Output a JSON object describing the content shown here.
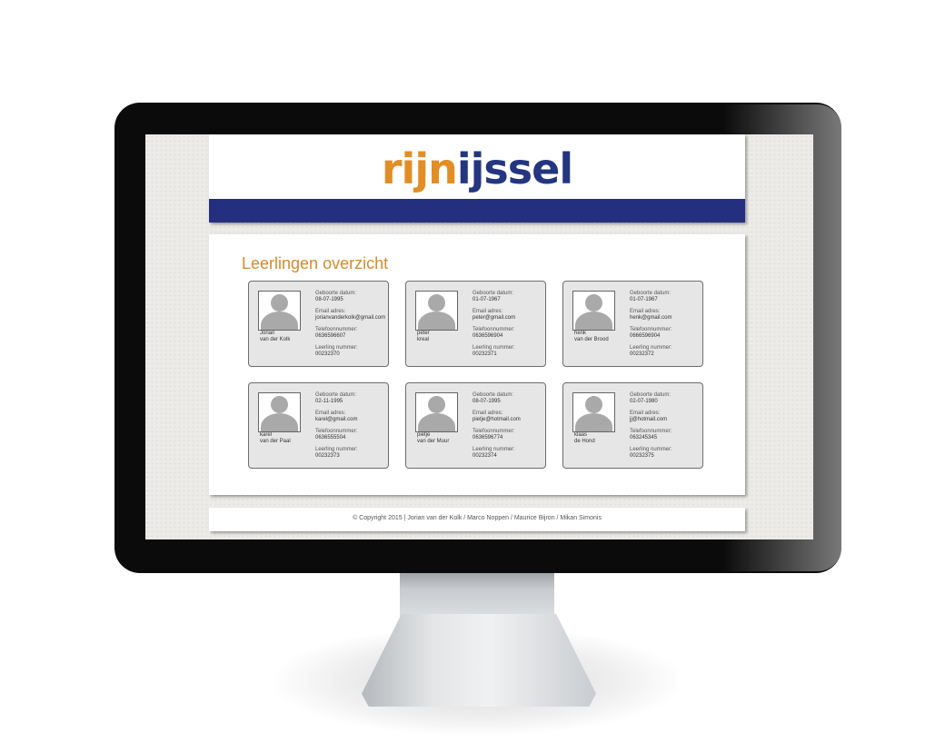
{
  "logo": {
    "part1": "rijn",
    "part2": "ijssel"
  },
  "page_title": "Leerlingen overzicht",
  "labels": {
    "birth": "Geboorte datum:",
    "email": "Email adres:",
    "phone": "Telefoonnummer:",
    "number": "Leerling nummer:"
  },
  "students": [
    {
      "first": "Jorian",
      "last": "van der Kolk",
      "birth": "08-07-1995",
      "email": "jorianvanderkolk@gmail.com",
      "phone": "0636596607",
      "number": "00232370"
    },
    {
      "first": "peter",
      "last": "kreal",
      "birth": "01-07-1967",
      "email": "peter@gmail.com",
      "phone": "0636596904",
      "number": "00232371"
    },
    {
      "first": "henk",
      "last": "van der Brood",
      "birth": "01-07-1967",
      "email": "henk@gmail.com",
      "phone": "0666596904",
      "number": "00232372"
    },
    {
      "first": "karel",
      "last": "van der Paal",
      "birth": "02-11-1995",
      "email": "karel@gmail.com",
      "phone": "0636555504",
      "number": "00232373"
    },
    {
      "first": "pietje",
      "last": "van der Muur",
      "birth": "08-07-1995",
      "email": "pietje@hotmail.com",
      "phone": "0636596774",
      "number": "00232374"
    },
    {
      "first": "klaas",
      "last": "de Hond",
      "birth": "02-07-1980",
      "email": "jj@hotmail.com",
      "phone": "063245345",
      "number": "00232375"
    }
  ],
  "footer": {
    "text": "© Copyright 2015 | Jorian van der Kolk / Marco Noppen / Maurice Bijron / Mikan Simonis"
  },
  "colors": {
    "accent_orange": "#e28e25",
    "brand_blue": "#24307f"
  }
}
